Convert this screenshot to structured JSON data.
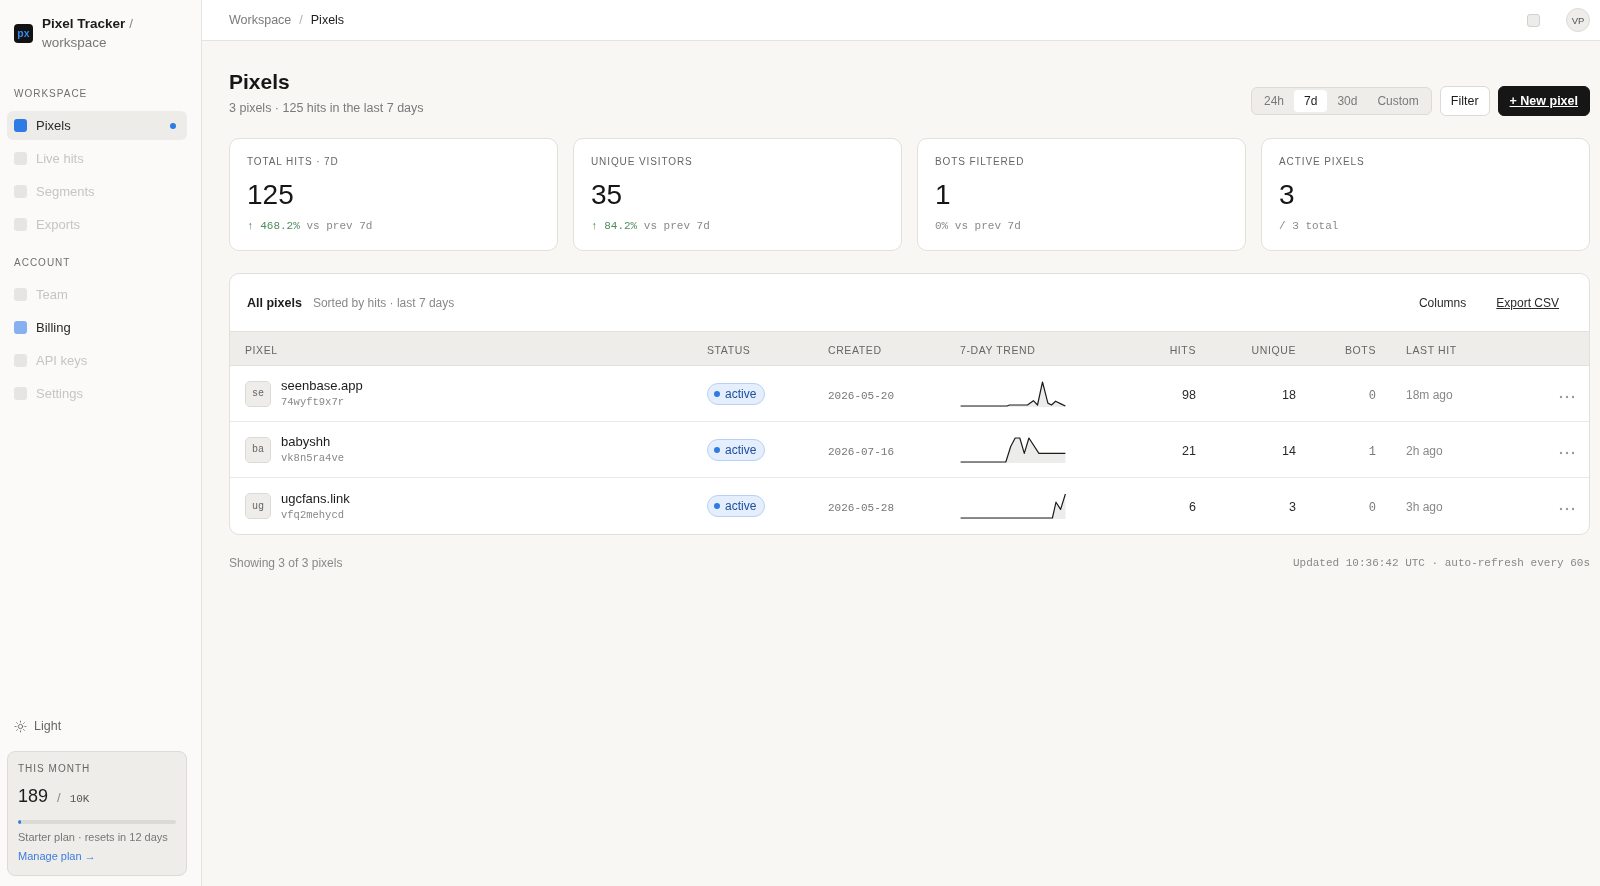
{
  "sidebar": {
    "brand": {
      "logo": "px",
      "name": "Pixel Tracker",
      "separator": "/",
      "workspace": "workspace"
    },
    "sections": [
      {
        "title": "WORKSPACE",
        "items": [
          {
            "label": "Pixels",
            "selected": true,
            "disabled": false
          },
          {
            "label": "Live hits",
            "selected": false,
            "disabled": true
          },
          {
            "label": "Segments",
            "selected": false,
            "disabled": true
          },
          {
            "label": "Exports",
            "selected": false,
            "disabled": true
          }
        ]
      },
      {
        "title": "ACCOUNT",
        "items": [
          {
            "label": "Team",
            "selected": false,
            "disabled": true
          },
          {
            "label": "Billing",
            "selected": false,
            "disabled": false
          },
          {
            "label": "API keys",
            "selected": false,
            "disabled": true
          },
          {
            "label": "Settings",
            "selected": false,
            "disabled": true
          }
        ]
      }
    ],
    "theme_toggle": {
      "label": "Light"
    },
    "usage": {
      "title": "THIS MONTH",
      "count": "189",
      "separator": "/",
      "limit": "10K",
      "level": 0.019,
      "plan": "Starter plan · resets in 12 days",
      "link": "Manage plan →"
    }
  },
  "header": {
    "breadcrumb": [
      {
        "label": "Workspace",
        "current": false
      },
      {
        "label": "Pixels",
        "current": true
      }
    ],
    "separator": "/",
    "user_initials": "VP"
  },
  "page": {
    "title": "Pixels",
    "subtitle": "3 pixels · 125 hits in the last 7 days",
    "ranges": [
      {
        "label": "24h",
        "selected": false
      },
      {
        "label": "7d",
        "selected": true
      },
      {
        "label": "30d",
        "selected": false
      },
      {
        "label": "Custom",
        "selected": false
      }
    ],
    "filter_button": "Filter",
    "new_button": "+ New pixel"
  },
  "stats": [
    {
      "label": "TOTAL HITS · 7D",
      "value": "125",
      "change": {
        "text": "↑ 468.2%",
        "kind": "up"
      },
      "caption": "vs prev 7d"
    },
    {
      "label": "UNIQUE VISITORS",
      "value": "35",
      "change": {
        "text": "↑ 84.2%",
        "kind": "up"
      },
      "caption": "vs prev 7d"
    },
    {
      "label": "BOTS FILTERED",
      "value": "1",
      "change": {
        "text": "0%",
        "kind": "flat"
      },
      "caption": "vs prev 7d"
    },
    {
      "label": "ACTIVE PIXELS",
      "value": "3",
      "caption": "/ 3 total"
    }
  ],
  "table": {
    "title": "All pixels",
    "subtitle": "Sorted by hits · last 7 days",
    "actions": [
      {
        "label": "Columns",
        "kind": "button"
      },
      {
        "label": "Export CSV",
        "kind": "link"
      }
    ],
    "columns": [
      {
        "label": "PIXEL",
        "kind": "text"
      },
      {
        "label": "STATUS",
        "kind": "text"
      },
      {
        "label": "CREATED",
        "kind": "text"
      },
      {
        "label": "7-DAY TREND",
        "kind": "text"
      },
      {
        "label": "HITS",
        "kind": "number"
      },
      {
        "label": "UNIQUE",
        "kind": "number"
      },
      {
        "label": "BOTS",
        "kind": "number"
      },
      {
        "label": "LAST HIT",
        "kind": "text"
      }
    ],
    "rows": [
      {
        "initials": "se",
        "name": "seenbase.app",
        "id": "74wyft9x7r",
        "status": {
          "label": "active",
          "kind": "active"
        },
        "created": "2026-05-20",
        "hits": "98",
        "unique": "18",
        "bots": "0",
        "last_hit": "18m ago"
      },
      {
        "initials": "ba",
        "name": "babyshh",
        "id": "vk8n5ra4ve",
        "status": {
          "label": "active",
          "kind": "active"
        },
        "created": "2026-07-16",
        "hits": "21",
        "unique": "14",
        "bots": "1",
        "last_hit": "2h ago"
      },
      {
        "initials": "ug",
        "name": "ugcfans.link",
        "id": "vfq2mehycd",
        "status": {
          "label": "active",
          "kind": "active"
        },
        "created": "2026-05-28",
        "hits": "6",
        "unique": "3",
        "bots": "0",
        "last_hit": "3h ago"
      }
    ]
  },
  "footer": {
    "count": "Showing 3 of 3 pixels",
    "updated": "Updated 10:36:42 UTC · auto-refresh every 60s"
  }
}
